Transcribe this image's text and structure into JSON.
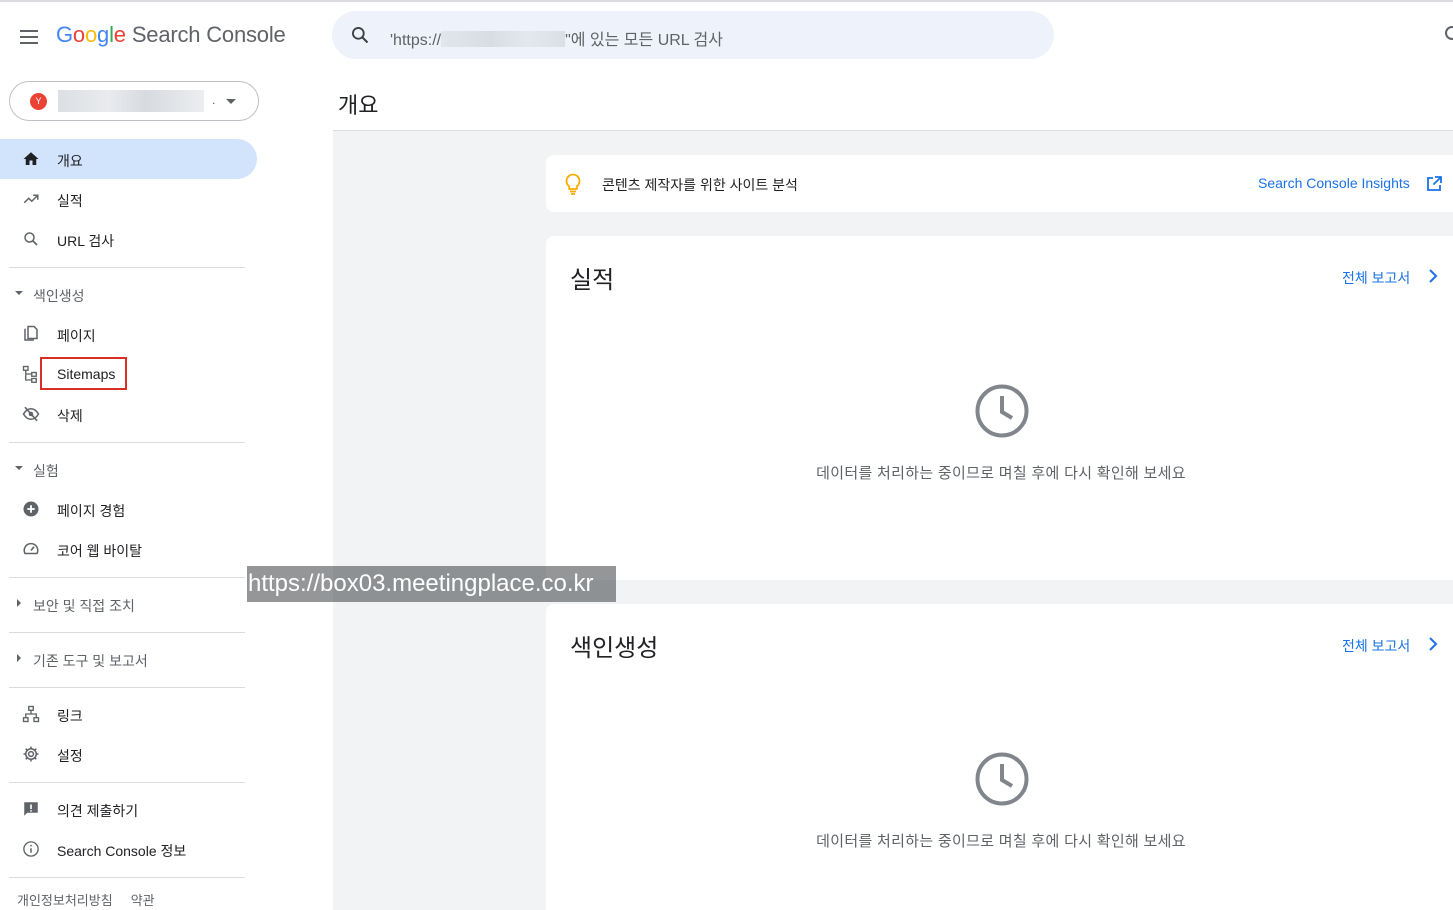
{
  "app": {
    "logo_google": [
      "G",
      "o",
      "o",
      "g",
      "l",
      "e"
    ],
    "logo_product": "Search Console"
  },
  "search": {
    "text_prefix": "'https://",
    "text_suffix": "\"에 있는 모든 URL 검사"
  },
  "property": {
    "favicon_text": "Y",
    "name_suffix": "."
  },
  "sidebar": {
    "primary": [
      {
        "label": "개요",
        "icon": "home-icon",
        "active": true
      },
      {
        "label": "실적",
        "icon": "trending-up-icon"
      },
      {
        "label": "URL 검사",
        "icon": "search-icon"
      }
    ],
    "indexing_header": "색인생성",
    "indexing_items": [
      {
        "label": "페이지",
        "icon": "pages-icon"
      },
      {
        "label": "Sitemaps",
        "icon": "sitemap-icon"
      },
      {
        "label": "삭제",
        "icon": "eye-off-icon"
      }
    ],
    "experience_header": "실험",
    "experience_items": [
      {
        "label": "페이지 경험",
        "icon": "add-circle-icon"
      },
      {
        "label": "코어 웹 바이탈",
        "icon": "speedometer-icon"
      }
    ],
    "security_header": "보안 및 직접 조치",
    "legacy_header": "기존 도구 및 보고서",
    "misc_items": [
      {
        "label": "링크",
        "icon": "links-icon"
      },
      {
        "label": "설정",
        "icon": "settings-gear-icon"
      }
    ],
    "help_items": [
      {
        "label": "의견 제출하기",
        "icon": "feedback-icon"
      },
      {
        "label": "Search Console 정보",
        "icon": "info-icon"
      }
    ],
    "footer": {
      "privacy": "개인정보처리방침",
      "terms": "약관"
    }
  },
  "main": {
    "title": "개요",
    "insights": {
      "text": "콘텐츠 제작자를 위한 사이트 분석",
      "link": "Search Console Insights"
    },
    "performance": {
      "title": "실적",
      "link": "전체 보고서",
      "message": "데이터를 처리하는 중이므로 며칠 후에 다시 확인해 보세요"
    },
    "indexing": {
      "title": "색인생성",
      "link": "전체 보고서",
      "message": "데이터를 처리하는 중이므로 며칠 후에 다시 확인해 보세요"
    }
  },
  "watermark": "https://box03.meetingplace.co.kr",
  "colors": {
    "accent": "#1a73e8",
    "active_nav": "#d2e3fc",
    "highlight_box": "#d93025",
    "page_bg": "#f1f3f4"
  }
}
